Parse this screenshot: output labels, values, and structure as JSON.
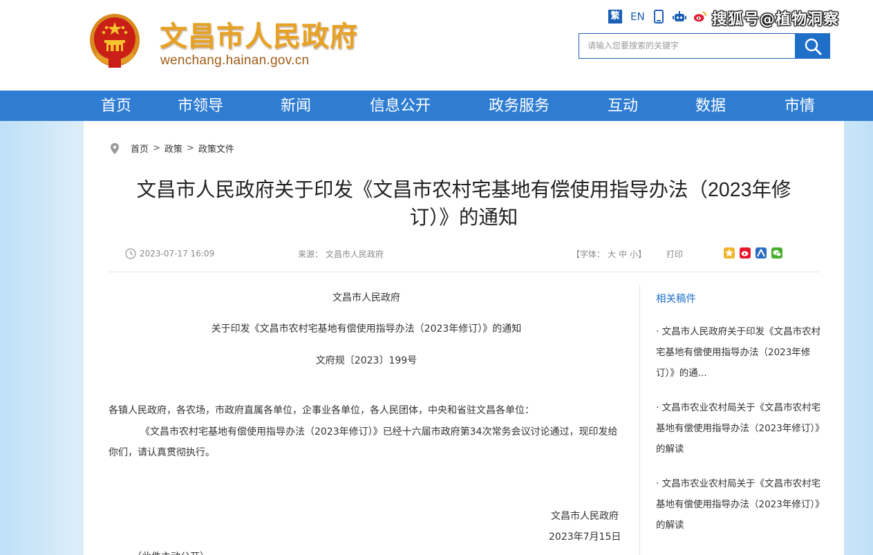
{
  "header": {
    "site_title": "文昌市人民政府",
    "site_domain": "wenchang.hainan.gov.cn",
    "traditional_label": "繁",
    "english_label": "EN",
    "watermark": "搜狐号@植物洞察",
    "search_placeholder": "请输入您要搜索的关键字",
    "colors": {
      "title": "#e7a224",
      "brand_blue": "#2f7dd3"
    }
  },
  "nav": {
    "items": [
      "首页",
      "市领导",
      "新闻",
      "信息公开",
      "政务服务",
      "互动",
      "数据",
      "市情"
    ]
  },
  "breadcrumb": {
    "items": [
      "首页",
      "政策",
      "政策文件"
    ],
    "separator": ">"
  },
  "article": {
    "title_line1": "文昌市人民政府关于印发《文昌市农村宅基地有偿使用指导办法（2023年修",
    "title_line2": "订）》的通知",
    "date": "2023-07-17 16:09",
    "source_label": "来源：",
    "source": "文昌市人民政府",
    "font_label": "【字体：",
    "font_large": "大",
    "font_medium": "中",
    "font_small": "小】",
    "print_label": "打印",
    "issuer": "文昌市人民政府",
    "doc_title": "关于印发《文昌市农村宅基地有偿使用指导办法（2023年修订）》的通知",
    "doc_number": "文府规〔2023〕199号",
    "recipients": "各镇人民政府，各农场，市政府直属各单位，企事业各单位，各人民团体，中央和省驻文昌各单位：",
    "body_paragraph": "《文昌市农村宅基地有偿使用指导办法（2023年修订）》已经十六届市政府第34次常务会议讨论通过，现印发给你们，请认真贯彻执行。",
    "signature": "文昌市人民政府",
    "sign_date": "2023年7月15日",
    "disclosure": "（此件主动公开）"
  },
  "related": {
    "heading": "相关稿件",
    "items": [
      "· 文昌市人民政府关于印发《文昌市农村宅基地有偿使用指导办法（2023年修订）》的通...",
      "· 文昌市农业农村局关于《文昌市农村宅基地有偿使用指导办法（2023年修订）》的解读",
      "· 文昌市农业农村局关于《文昌市农村宅基地有偿使用指导办法（2023年修订）》的解读"
    ]
  }
}
